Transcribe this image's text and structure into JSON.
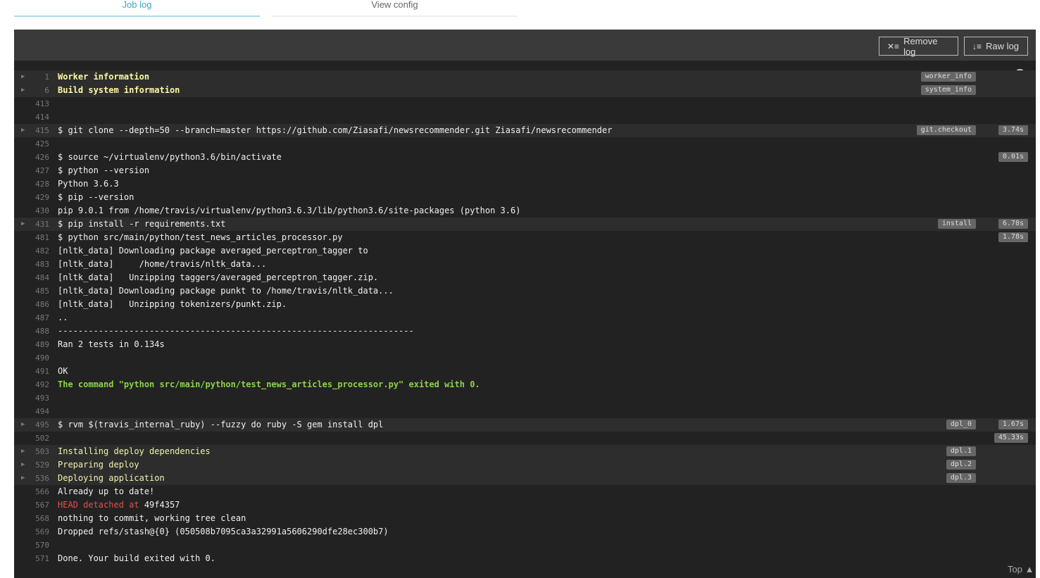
{
  "tabs": {
    "job_log": "Job log",
    "view_config": "View config"
  },
  "header": {
    "remove_log": "Remove log",
    "raw_log": "Raw log"
  },
  "top_label": "Top",
  "lines": [
    {
      "n": "1",
      "fold": true,
      "style": "yb",
      "text": "Worker information",
      "tag": "worker_info"
    },
    {
      "n": "6",
      "fold": true,
      "style": "yb",
      "text": "Build system information",
      "tag": "system_info"
    },
    {
      "n": "413",
      "text": ""
    },
    {
      "n": "414",
      "text": ""
    },
    {
      "n": "415",
      "fold": true,
      "text": "$ git clone --depth=50 --branch=master https://github.com/Ziasafi/newsrecommender.git Ziasafi/newsrecommender",
      "tag": "git.checkout",
      "dur": "3.74s"
    },
    {
      "n": "425",
      "text": ""
    },
    {
      "n": "426",
      "text": "$ source ~/virtualenv/python3.6/bin/activate",
      "dur": "0.01s"
    },
    {
      "n": "427",
      "text": "$ python --version"
    },
    {
      "n": "428",
      "text": "Python 3.6.3"
    },
    {
      "n": "429",
      "text": "$ pip --version"
    },
    {
      "n": "430",
      "text": "pip 9.0.1 from /home/travis/virtualenv/python3.6.3/lib/python3.6/site-packages (python 3.6)"
    },
    {
      "n": "431",
      "fold": true,
      "text": "$ pip install -r requirements.txt",
      "tag": "install",
      "dur": "6.78s"
    },
    {
      "n": "481",
      "text": "$ python src/main/python/test_news_articles_processor.py",
      "dur": "1.78s"
    },
    {
      "n": "482",
      "text": "[nltk_data] Downloading package averaged_perceptron_tagger to"
    },
    {
      "n": "483",
      "text": "[nltk_data]     /home/travis/nltk_data..."
    },
    {
      "n": "484",
      "text": "[nltk_data]   Unzipping taggers/averaged_perceptron_tagger.zip."
    },
    {
      "n": "485",
      "text": "[nltk_data] Downloading package punkt to /home/travis/nltk_data..."
    },
    {
      "n": "486",
      "text": "[nltk_data]   Unzipping tokenizers/punkt.zip."
    },
    {
      "n": "487",
      "text": ".."
    },
    {
      "n": "488",
      "text": "----------------------------------------------------------------------"
    },
    {
      "n": "489",
      "text": "Ran 2 tests in 0.134s"
    },
    {
      "n": "490",
      "text": ""
    },
    {
      "n": "491",
      "text": "OK"
    },
    {
      "n": "492",
      "style": "gb",
      "text": "The command \"python src/main/python/test_news_articles_processor.py\" exited with 0."
    },
    {
      "n": "493",
      "text": ""
    },
    {
      "n": "494",
      "text": ""
    },
    {
      "n": "495",
      "fold": true,
      "text": "$ rvm $(travis_internal_ruby) --fuzzy do ruby -S gem install dpl",
      "tag": "dpl_0",
      "dur": "1.67s"
    },
    {
      "n": "502",
      "text": "",
      "dur": "45.33s"
    },
    {
      "n": "503",
      "fold": true,
      "style": "y",
      "text": "Installing deploy dependencies",
      "tag": "dpl.1"
    },
    {
      "n": "529",
      "fold": true,
      "style": "y",
      "text": "Preparing deploy",
      "tag": "dpl.2"
    },
    {
      "n": "536",
      "fold": true,
      "style": "y",
      "text": "Deploying application",
      "tag": "dpl.3"
    },
    {
      "n": "566",
      "text": "Already up to date!"
    },
    {
      "n": "567",
      "red": "HEAD detached at",
      "text": " 49f4357"
    },
    {
      "n": "568",
      "text": "nothing to commit, working tree clean"
    },
    {
      "n": "569",
      "text": "Dropped refs/stash@{0} (050508b7095ca3a32991a5606290dfe28ec300b7)"
    },
    {
      "n": "570",
      "text": ""
    },
    {
      "n": "571",
      "text": "Done. Your build exited with 0."
    }
  ]
}
